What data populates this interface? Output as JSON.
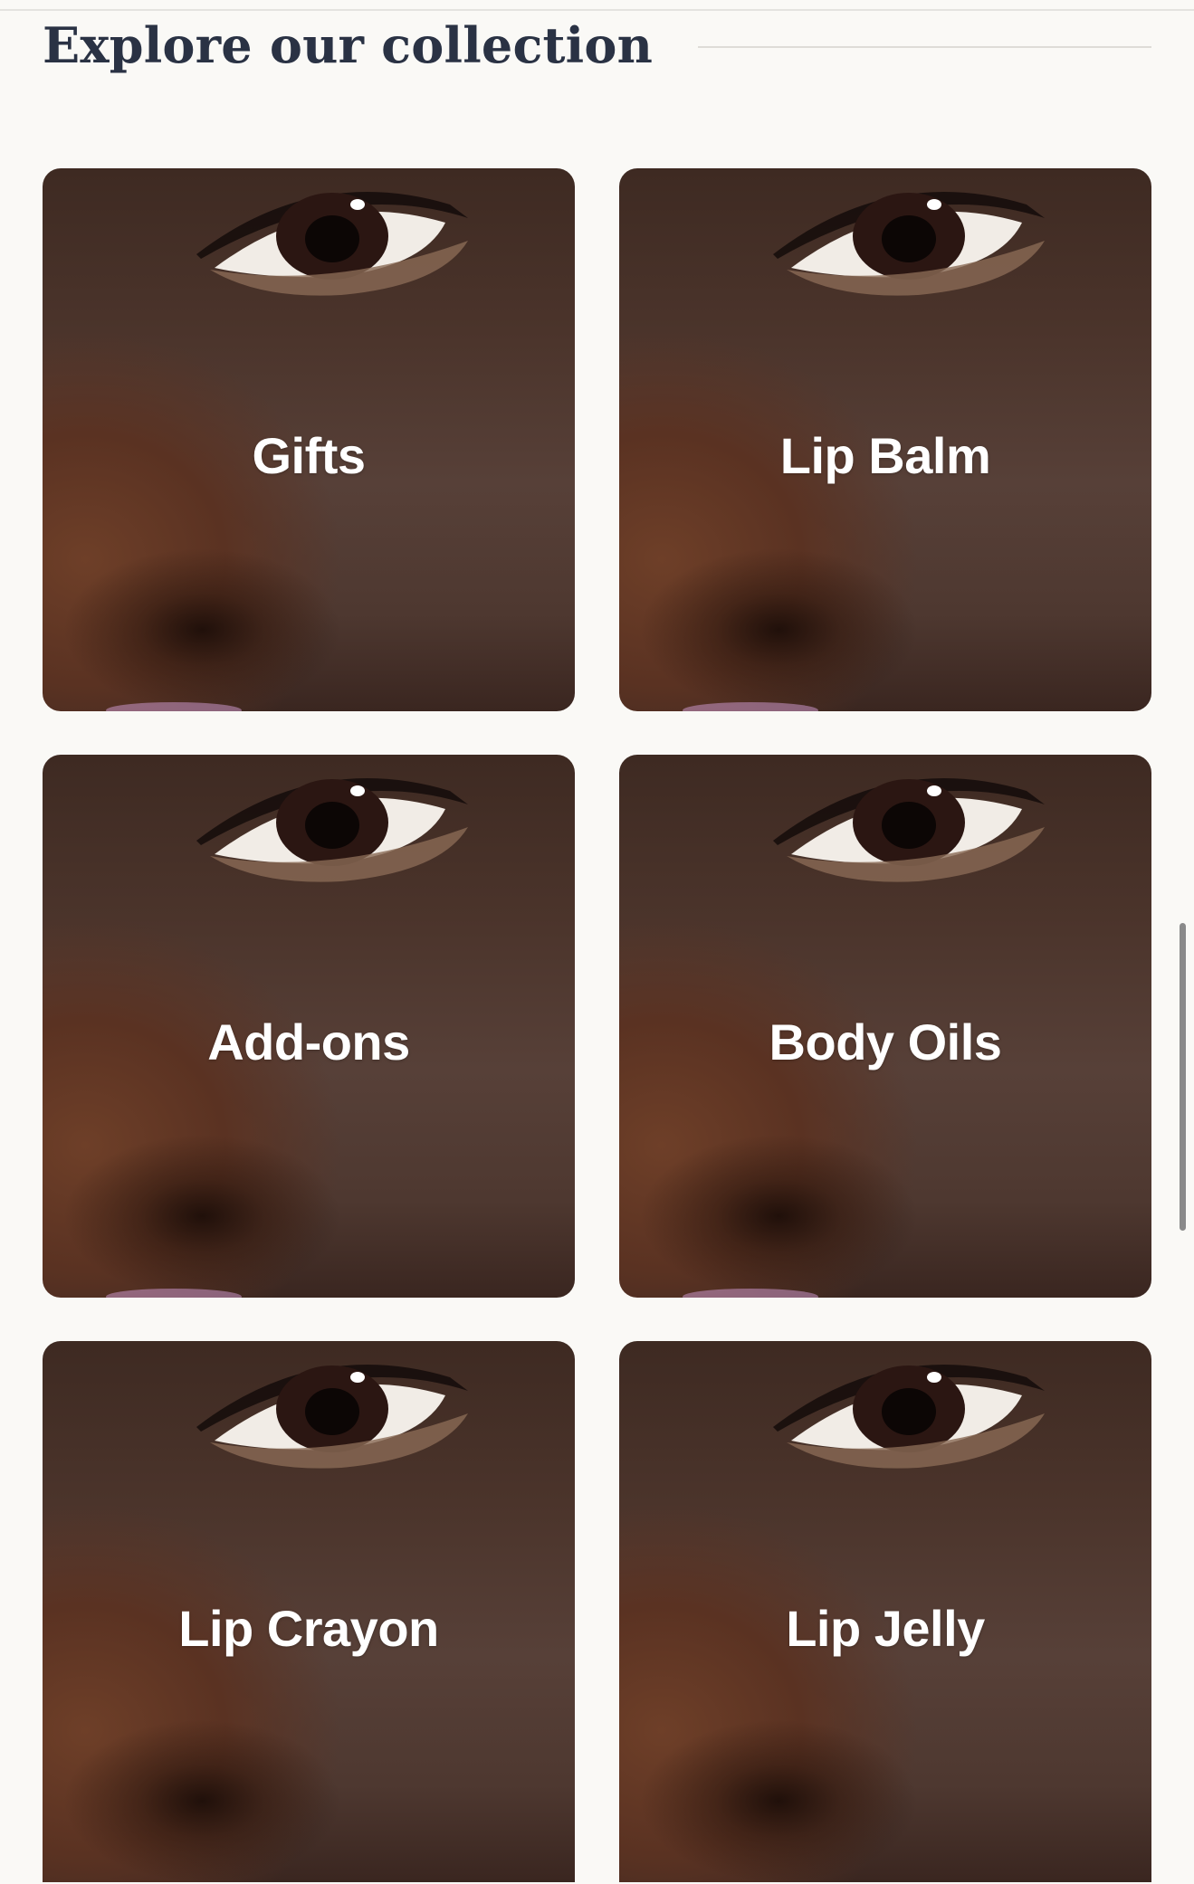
{
  "section": {
    "title": "Explore our collection"
  },
  "collections": [
    {
      "label": "Gifts"
    },
    {
      "label": "Lip Balm"
    },
    {
      "label": "Add-ons"
    },
    {
      "label": "Body Oils"
    },
    {
      "label": "Lip Crayon"
    },
    {
      "label": "Lip Jelly"
    }
  ]
}
